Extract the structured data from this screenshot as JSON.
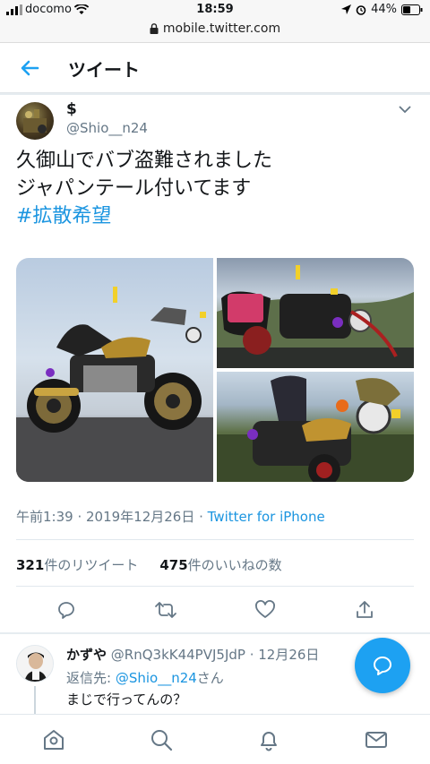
{
  "status_bar": {
    "carrier": "docomo",
    "time": "18:59",
    "battery": "44%"
  },
  "browser": {
    "url": "mobile.twitter.com"
  },
  "header": {
    "title": "ツイート"
  },
  "tweet": {
    "display_name": "$",
    "handle": "@Shio__n24",
    "text_line1": "久御山でバブ盗難されました",
    "text_line2": "ジャパンテール付いてます",
    "hashtag": "#拡散希望",
    "time": "午前1:39 · 2019年12月26日 · ",
    "source": "Twitter for iPhone",
    "retweet_count": "321",
    "retweet_label": "件のリツイート",
    "like_count": "475",
    "like_label": "件のいいねの数"
  },
  "reply": {
    "name": "かずや",
    "handle_date": "@RnQ3kK44PVJ5JdP · 12月26日",
    "reply_to_prefix": "返信先: ",
    "reply_to_mention": "@Shio__n24",
    "reply_to_suffix": "さん",
    "text": "まじで行ってんの？"
  },
  "icons": {
    "back": "arrow-left-icon",
    "caret": "chevron-down-icon",
    "reply": "reply-icon",
    "retweet": "retweet-icon",
    "like": "heart-icon",
    "share": "share-icon",
    "home": "home-icon",
    "search": "search-icon",
    "notifications": "bell-icon",
    "messages": "mail-icon",
    "compose": "compose-reply-icon"
  },
  "colors": {
    "accent": "#1da1f2",
    "link": "#1b95e0",
    "secondary_text": "#657786"
  }
}
